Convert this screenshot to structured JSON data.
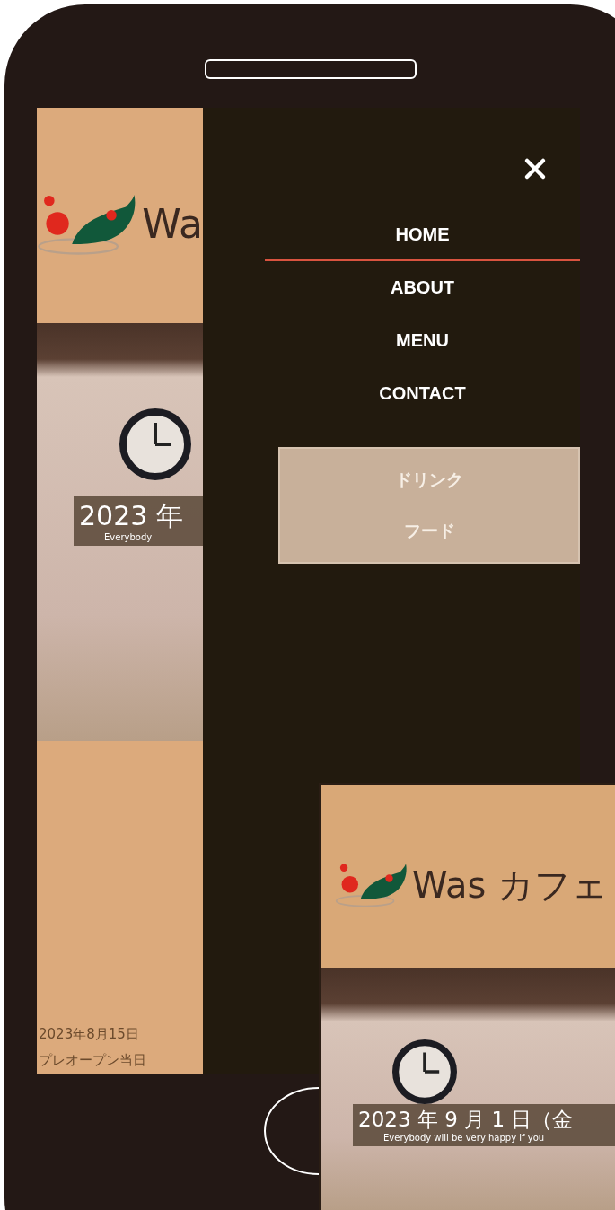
{
  "page": {
    "logo_text": "Wa",
    "hero_caption": "2023 年",
    "hero_subcaption": "Everybody",
    "news_date": "2023年8月15日",
    "news_title": "プレオープン当日"
  },
  "menu": {
    "items": [
      {
        "label": "HOME",
        "selected": true
      },
      {
        "label": "ABOUT",
        "selected": false
      },
      {
        "label": "MENU",
        "selected": false
      },
      {
        "label": "CONTACT",
        "selected": false
      }
    ],
    "submenu": [
      {
        "label": "ドリンク"
      },
      {
        "label": "フード"
      }
    ]
  },
  "inset": {
    "logo_text": "Was カフェ",
    "hero_caption": "2023 年 9 月 1 日（金",
    "hero_subcaption": "Everybody will be very happy if you"
  }
}
